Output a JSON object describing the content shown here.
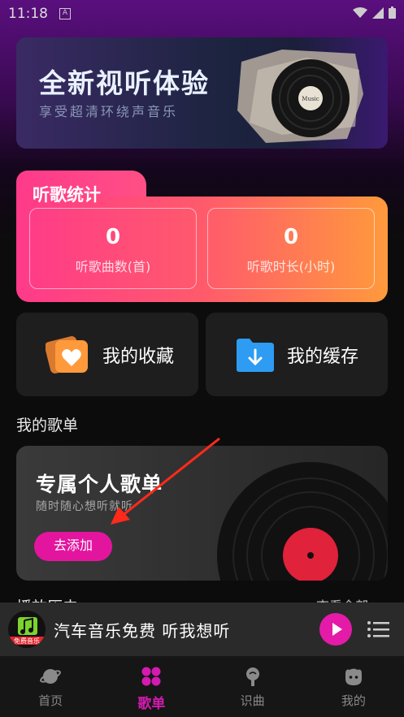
{
  "status_bar": {
    "time": "11:18",
    "notification_glyph": "A"
  },
  "banner": {
    "title": "全新视听体验",
    "subtitle": "享受超清环绕声音乐",
    "record_label": "Music"
  },
  "stats": {
    "title": "听歌统计",
    "items": [
      {
        "value": "0",
        "label": "听歌曲数(首)"
      },
      {
        "value": "0",
        "label": "听歌时长(小时)"
      }
    ]
  },
  "quick": {
    "favorites_label": "我的收藏",
    "cache_label": "我的缓存"
  },
  "my_playlists": {
    "section_title": "我的歌单",
    "card_title": "专属个人歌单",
    "card_subtitle": "随时随心想听就听",
    "add_button": "去添加"
  },
  "section2": {
    "title": "播放历史",
    "more": "查看全部"
  },
  "mini_player": {
    "track": "汽车音乐免费  听我想听",
    "art_caption": "免费音乐"
  },
  "tabs": [
    {
      "label": "首页",
      "icon": "planet-icon",
      "active": false
    },
    {
      "label": "歌单",
      "icon": "grid-icon",
      "active": true
    },
    {
      "label": "识曲",
      "icon": "mic-icon",
      "active": false
    },
    {
      "label": "我的",
      "icon": "face-icon",
      "active": false
    }
  ],
  "colors": {
    "accent": "#e3159f",
    "stats_start": "#ff3a8a",
    "stats_end": "#ff9a3c"
  }
}
